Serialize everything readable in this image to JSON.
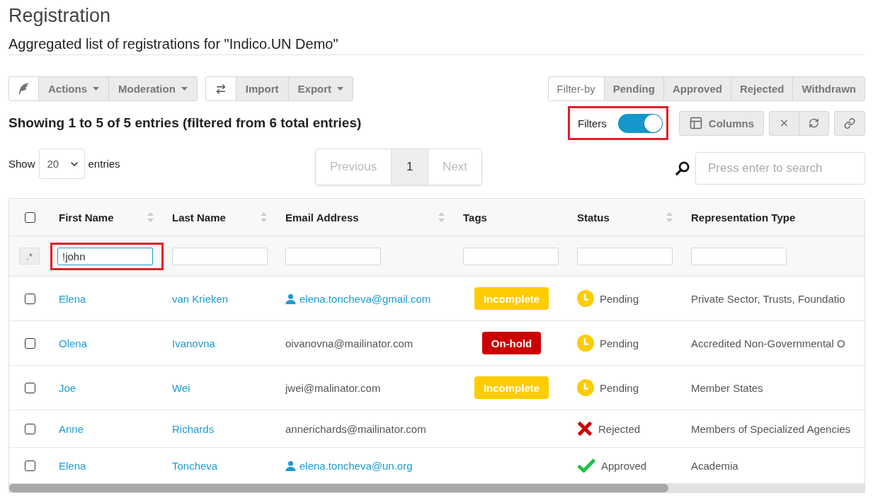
{
  "page": {
    "title": "Registration",
    "subtitle": "Aggregated list of registrations for \"Indico.UN Demo\""
  },
  "toolbar": {
    "moderation_group": [
      {
        "label": "Actions",
        "dropdown": true
      },
      {
        "label": "Moderation",
        "dropdown": true
      }
    ],
    "import_group": [
      {
        "label": "Import",
        "dropdown": false
      },
      {
        "label": "Export",
        "dropdown": true
      }
    ],
    "filter_by": {
      "label": "Filter-by",
      "options": [
        {
          "label": "Pending",
          "selected": false
        },
        {
          "label": "Approved",
          "selected": false
        },
        {
          "label": "Rejected",
          "selected": false
        },
        {
          "label": "Withdrawn",
          "selected": false
        }
      ]
    }
  },
  "summary": "Showing 1 to 5 of 5 entries (filtered from 6 total entries)",
  "filters_toggle": {
    "label": "Filters",
    "on": true,
    "highlighted": true
  },
  "columns_button": {
    "label": "Columns"
  },
  "page_size": {
    "label_before": "Show",
    "value": "20",
    "label_after": "entries"
  },
  "pagination": [
    {
      "label": "Previous",
      "selected": false,
      "disabled": true
    },
    {
      "label": "1",
      "selected": true,
      "disabled": false
    },
    {
      "label": "Next",
      "selected": false,
      "disabled": true
    }
  ],
  "search": {
    "placeholder": "Press enter to search"
  },
  "table": {
    "select_all": {
      "checked": false
    },
    "columns": [
      {
        "label": "First Name",
        "sortable": true
      },
      {
        "label": "Last Name",
        "sortable": true
      },
      {
        "label": "Email Address",
        "sortable": true
      },
      {
        "label": "Tags",
        "sortable": false
      },
      {
        "label": "Status",
        "sortable": true
      },
      {
        "label": "Representation Type",
        "sortable": false
      }
    ],
    "filter_row": {
      "regex_toggle": ".*",
      "inputs": [
        {
          "value": "!john",
          "focused": true,
          "highlighted": true
        },
        {
          "focused": false,
          "highlighted": false
        },
        {
          "focused": false,
          "highlighted": false
        },
        {
          "focused": false,
          "highlighted": false
        },
        {
          "focused": false,
          "highlighted": false
        },
        {
          "focused": false,
          "highlighted": false
        }
      ]
    },
    "rows": [
      {
        "checked": false,
        "first_name": "Elena",
        "last_name": "van Krieken",
        "email": {
          "text": "elena.toncheva@gmail.com",
          "linked_user": true
        },
        "tags": [
          {
            "label": "Incomplete",
            "color": "#ffcc00"
          }
        ],
        "status": {
          "kind": "pending",
          "label": "Pending"
        },
        "representation_type": "Private Sector, Trusts, Foundatio"
      },
      {
        "checked": false,
        "first_name": "Olena",
        "last_name": "Ivanovna",
        "email": {
          "text": "oivanovna@mailinator.com",
          "linked_user": false
        },
        "tags": [
          {
            "label": "On-hold",
            "color": "#cc0000"
          }
        ],
        "status": {
          "kind": "pending",
          "label": "Pending"
        },
        "representation_type": "Accredited Non-Governmental O"
      },
      {
        "checked": false,
        "first_name": "Joe",
        "last_name": "Wei",
        "email": {
          "text": "jwei@malinator.com",
          "linked_user": false
        },
        "tags": [
          {
            "label": "Incomplete",
            "color": "#ffcc00"
          }
        ],
        "status": {
          "kind": "pending",
          "label": "Pending"
        },
        "representation_type": "Member States"
      },
      {
        "checked": false,
        "first_name": "Anne",
        "last_name": "Richards",
        "email": {
          "text": "annerichards@mailinator.com",
          "linked_user": false
        },
        "status": {
          "kind": "rejected",
          "label": "Rejected"
        },
        "representation_type": "Members of Specialized Agencies"
      },
      {
        "checked": false,
        "first_name": "Elena",
        "last_name": "Toncheva",
        "email": {
          "text": "elena.toncheva@un.org",
          "linked_user": true
        },
        "status": {
          "kind": "approved",
          "label": "Approved"
        },
        "representation_type": "Academia"
      }
    ]
  }
}
